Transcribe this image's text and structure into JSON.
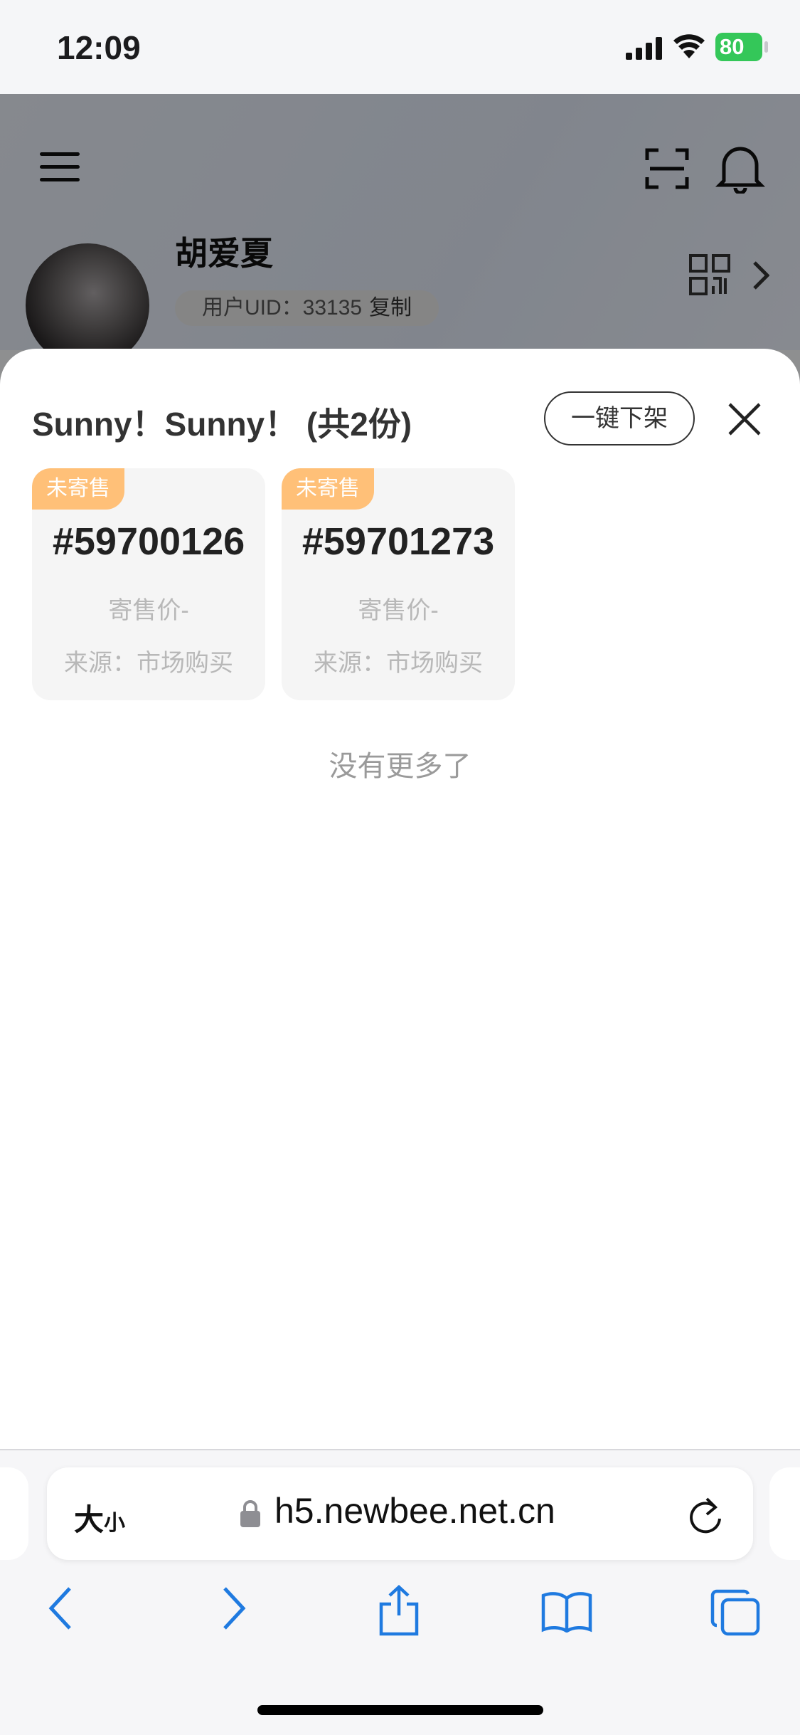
{
  "status_bar": {
    "time": "12:09",
    "battery": "80"
  },
  "profile": {
    "name": "胡爱夏",
    "uid_label": "用户UID：33135",
    "copy_label": "复制"
  },
  "sheet": {
    "title": "Sunny！Sunny！ (共2份)",
    "unlist_all_label": "一键下架",
    "cards": [
      {
        "badge": "未寄售",
        "number": "#59700126",
        "price": "寄售价-",
        "source": "来源：市场购买"
      },
      {
        "badge": "未寄售",
        "number": "#59701273",
        "price": "寄售价-",
        "source": "来源：市场购买"
      }
    ],
    "no_more": "没有更多了"
  },
  "browser": {
    "text_size_big": "大",
    "text_size_small": "小",
    "url": "h5.newbee.net.cn"
  },
  "colors": {
    "badge": "#ffc078",
    "battery": "#34c759",
    "ios_blue": "#1f7ae0"
  },
  "icons": [
    "menu-icon",
    "scan-icon",
    "bell-icon",
    "qr-code-icon",
    "chevron-right-icon",
    "close-icon",
    "lock-icon",
    "reload-icon",
    "back-icon",
    "forward-icon",
    "share-icon",
    "bookmarks-icon",
    "tabs-icon"
  ]
}
